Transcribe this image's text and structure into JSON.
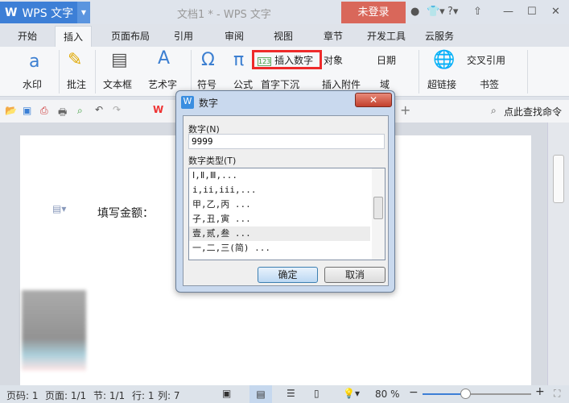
{
  "app": {
    "name": "WPS 文字",
    "doc_title": "文档1 * - WPS 文字",
    "login": "未登录"
  },
  "tabs": [
    "开始",
    "插入",
    "页面布局",
    "引用",
    "审阅",
    "视图",
    "章节",
    "开发工具",
    "云服务"
  ],
  "ribbon": {
    "watermark": "水印",
    "comment": "批注",
    "textbox": "文本框",
    "wordart": "艺术字",
    "symbol": "符号",
    "formula": "公式",
    "insert_number": "插入数字",
    "object": "对象",
    "date": "日期",
    "dropcap": "首字下沉",
    "attachment": "插入附件",
    "field": "域",
    "hyperlink": "超链接",
    "crossref": "交叉引用",
    "bookmark": "书签"
  },
  "quick": {
    "search": "点此查找命令"
  },
  "document": {
    "text": "填写金额："
  },
  "dialog": {
    "title": "数字",
    "number_label": "数字(N)",
    "number_value": "9999",
    "type_label": "数字类型(T)",
    "types": [
      "Ⅰ,Ⅱ,Ⅲ,...",
      "i,ii,iii,...",
      "甲,乙,丙 ...",
      "子,丑,寅 ...",
      "壹,贰,叁 ...",
      "一,二,三(简) ..."
    ],
    "ok": "确定",
    "cancel": "取消"
  },
  "status": {
    "page": "页码: 1",
    "pages": "页面: 1/1",
    "section": "节: 1/1",
    "line": "行: 1",
    "col": "列: 7",
    "zoom": "80 %",
    "zoom_percent": 80
  }
}
